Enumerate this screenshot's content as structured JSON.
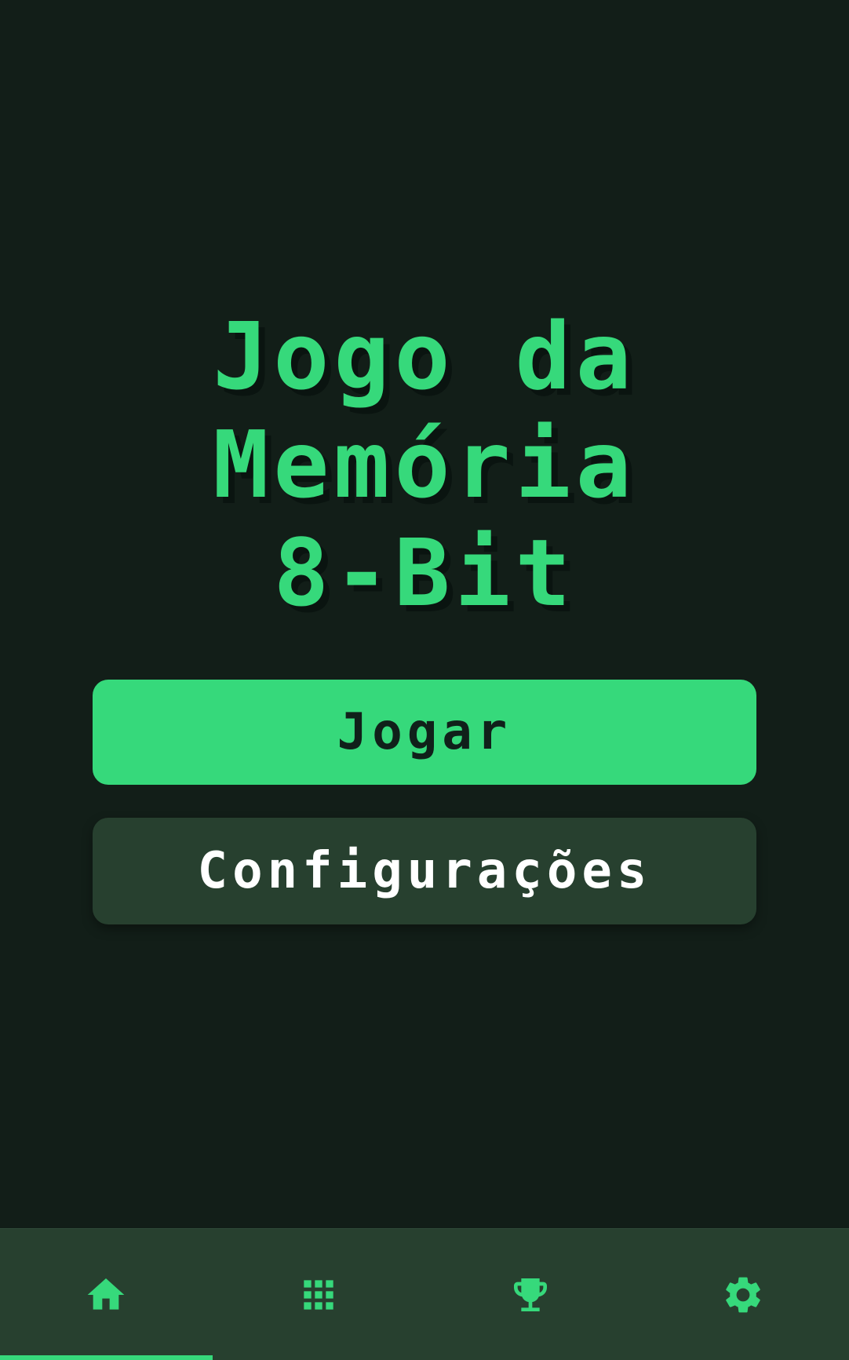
{
  "app": {
    "title_lines": [
      "Jogo da",
      "Memória",
      "8-Bit"
    ]
  },
  "buttons": {
    "play_label": "Jogar",
    "settings_label": "Configurações"
  },
  "bottom_nav": {
    "active_index": 0,
    "items": [
      {
        "icon": "home-icon"
      },
      {
        "icon": "grid-icon"
      },
      {
        "icon": "trophy-icon"
      },
      {
        "icon": "gear-icon"
      }
    ]
  },
  "colors": {
    "background": "#121e18",
    "accent": "#36d97b",
    "surface": "#27402f",
    "text_light": "#ffffff",
    "text_dark": "#10201a"
  }
}
